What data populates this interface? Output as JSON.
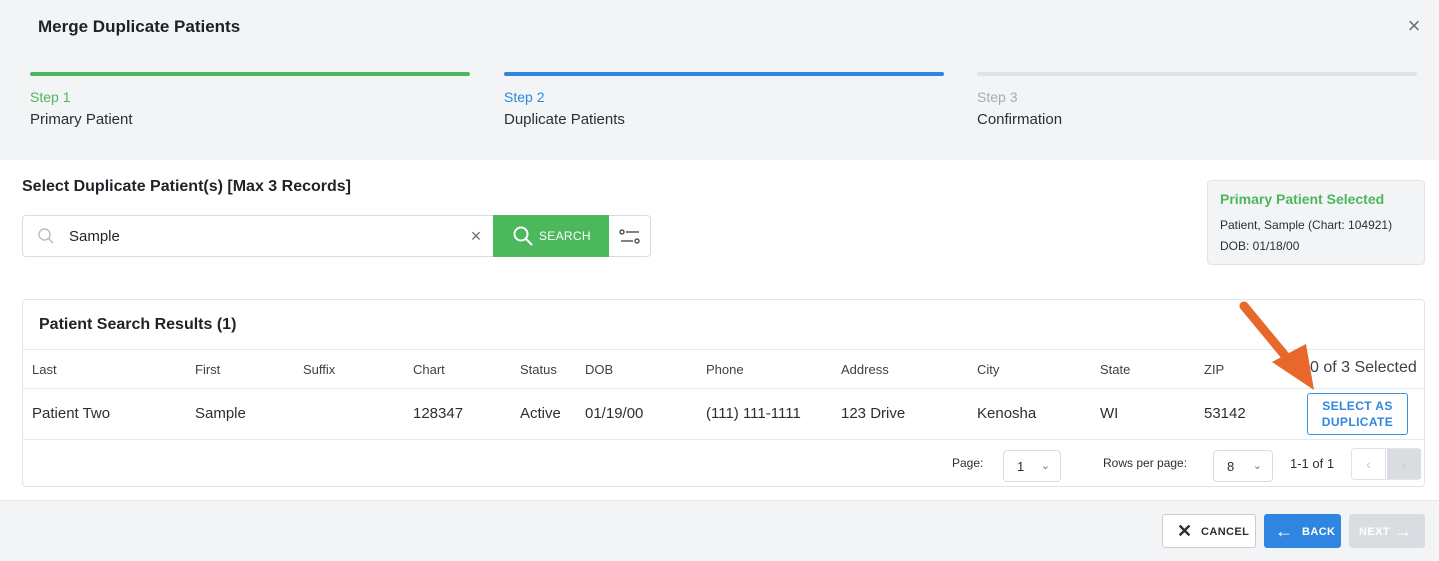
{
  "dialog": {
    "title": "Merge Duplicate Patients",
    "close_icon": "close-icon"
  },
  "steps": [
    {
      "num": "Step 1",
      "label": "Primary Patient",
      "state": "complete",
      "color": "#4cb85c"
    },
    {
      "num": "Step 2",
      "label": "Duplicate Patients",
      "state": "active",
      "color": "#2f86e0"
    },
    {
      "num": "Step 3",
      "label": "Confirmation",
      "state": "pending",
      "color": "#a7abb1"
    }
  ],
  "select": {
    "title": "Select Duplicate Patient(s) [Max 3 Records]",
    "search_value": "Sample",
    "search_button": "SEARCH",
    "icons": {
      "search": "search-icon",
      "clear": "clear-icon",
      "filter": "filter-icon"
    }
  },
  "primary": {
    "heading": "Primary Patient Selected",
    "line1": "Patient, Sample (Chart: 104921)",
    "line2": "DOB: 01/18/00"
  },
  "results": {
    "title": "Patient Search Results (1)",
    "columns": [
      "Last",
      "First",
      "Suffix",
      "Chart",
      "Status",
      "DOB",
      "Phone",
      "Address",
      "City",
      "State",
      "ZIP"
    ],
    "selected_count": "0 of 3 Selected",
    "rows": [
      {
        "last": "Patient Two",
        "first": "Sample",
        "suffix": "",
        "chart": "128347",
        "status": "Active",
        "dob": "01/19/00",
        "phone": "(111) 111-1111",
        "address": "123 Drive",
        "city": "Kenosha",
        "state": "WI",
        "zip": "53142",
        "action_line1": "SELECT AS",
        "action_line2": "DUPLICATE"
      }
    ],
    "pager": {
      "page_label": "Page:",
      "page_value": "1",
      "rows_label": "Rows per page:",
      "rows_value": "8",
      "range": "1-1 of 1"
    }
  },
  "footer": {
    "cancel": "CANCEL",
    "back": "BACK",
    "next": "NEXT"
  },
  "colors": {
    "green": "#4cb85c",
    "blue": "#2f86e0",
    "annotation_arrow": "#e8672a"
  }
}
